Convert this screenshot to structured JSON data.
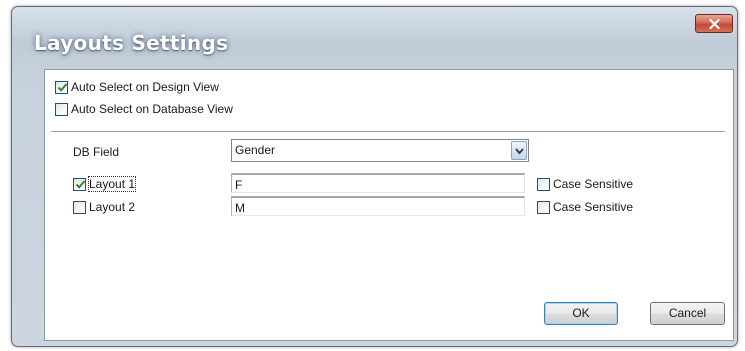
{
  "window": {
    "title": "Layouts Settings",
    "close_icon": "close-icon"
  },
  "options": {
    "auto_design_label": "Auto Select on Design View",
    "auto_design_checked": true,
    "auto_database_label": "Auto Select on Database View",
    "auto_database_checked": false
  },
  "db_field": {
    "label": "DB Field",
    "value": "Gender",
    "dropdown_icon": "chevron-down-icon"
  },
  "layouts": [
    {
      "label": "Layout 1",
      "checked": true,
      "value": "F",
      "case_label": "Case Sensitive",
      "case_checked": false
    },
    {
      "label": "Layout 2",
      "checked": false,
      "value": "M",
      "case_label": "Case Sensitive",
      "case_checked": false
    }
  ],
  "buttons": {
    "ok": "OK",
    "cancel": "Cancel"
  },
  "colors": {
    "window_frame": "#c7d1db",
    "close_button": "#c9533f",
    "checkbox_border": "#1c5180",
    "checkmark": "#2c8a26",
    "default_button_border": "#3c7fb1"
  }
}
